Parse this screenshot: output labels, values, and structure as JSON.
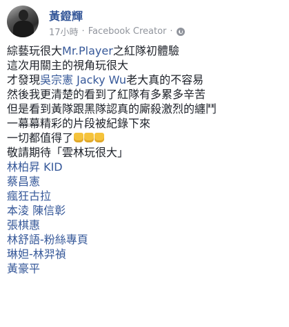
{
  "post": {
    "author": "黃鐙輝",
    "time": "17小時",
    "separator": "·",
    "role": "Facebook Creator",
    "privacy_icon": "globe-icon"
  },
  "lines": [
    {
      "pre": "綜藝玩很大",
      "tag": "Mr.Player",
      "post": "之紅隊初體驗"
    },
    {
      "pre": "這次用關主的視角玩很大"
    },
    {
      "pre": "才發現",
      "tag": "吳宗憲 Jacky Wu",
      "post": "老大真的不容易"
    },
    {
      "pre": "然後我更清楚的看到了紅隊有多累多辛苦"
    },
    {
      "pre": "但是看到黃隊跟黑隊認真的廝殺激烈的纏鬥"
    },
    {
      "pre": "一幕幕精彩的片段被紀錄下來"
    },
    {
      "pre": "一切都值得了",
      "emoji": "🙏🙏🙏"
    },
    {
      "pre": "敬請期待「雲林玩很大」"
    },
    {
      "tag": "林柏昇 KID"
    },
    {
      "tag": "蔡昌憲"
    },
    {
      "tag": "瘋狂古拉"
    },
    {
      "tag": "本淩 陳信彰"
    },
    {
      "tag": "張棋惠"
    },
    {
      "tag": "林舒語-粉絲專頁"
    },
    {
      "tag": "琳妲-林羿禎"
    },
    {
      "tag": "黃豪平"
    }
  ]
}
